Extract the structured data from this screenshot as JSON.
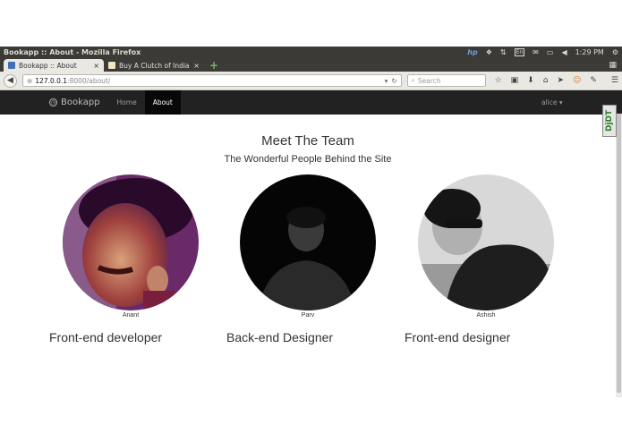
{
  "window": {
    "title": "Bookapp :: About - Mozilla Firefox"
  },
  "tray": {
    "hp": "hp",
    "keyboard": "En",
    "clock": "1:29 PM"
  },
  "tabs": [
    {
      "label": "Bookapp :: About",
      "close": "×",
      "active": true
    },
    {
      "label": "Buy A Clutch of India...",
      "close": "×",
      "active": false
    }
  ],
  "newtab": "+",
  "url": {
    "host": "127.0.0.1",
    "path": ":8000/about/"
  },
  "search": {
    "placeholder": "Search"
  },
  "app_nav": {
    "brand": "Bookapp",
    "links": [
      {
        "label": "Home",
        "active": false
      },
      {
        "label": "About",
        "active": true
      }
    ],
    "user": "alice ▾"
  },
  "debug_toolbar": {
    "label": "DjDT"
  },
  "page": {
    "title": "Meet The Team",
    "subtitle": "The Wonderful People Behind the Site"
  },
  "team": [
    {
      "name": "Anant",
      "role": "Front-end developer"
    },
    {
      "name": "Parv",
      "role": "Back-end Designer"
    },
    {
      "name": "Ashish",
      "role": "Front-end designer"
    }
  ]
}
